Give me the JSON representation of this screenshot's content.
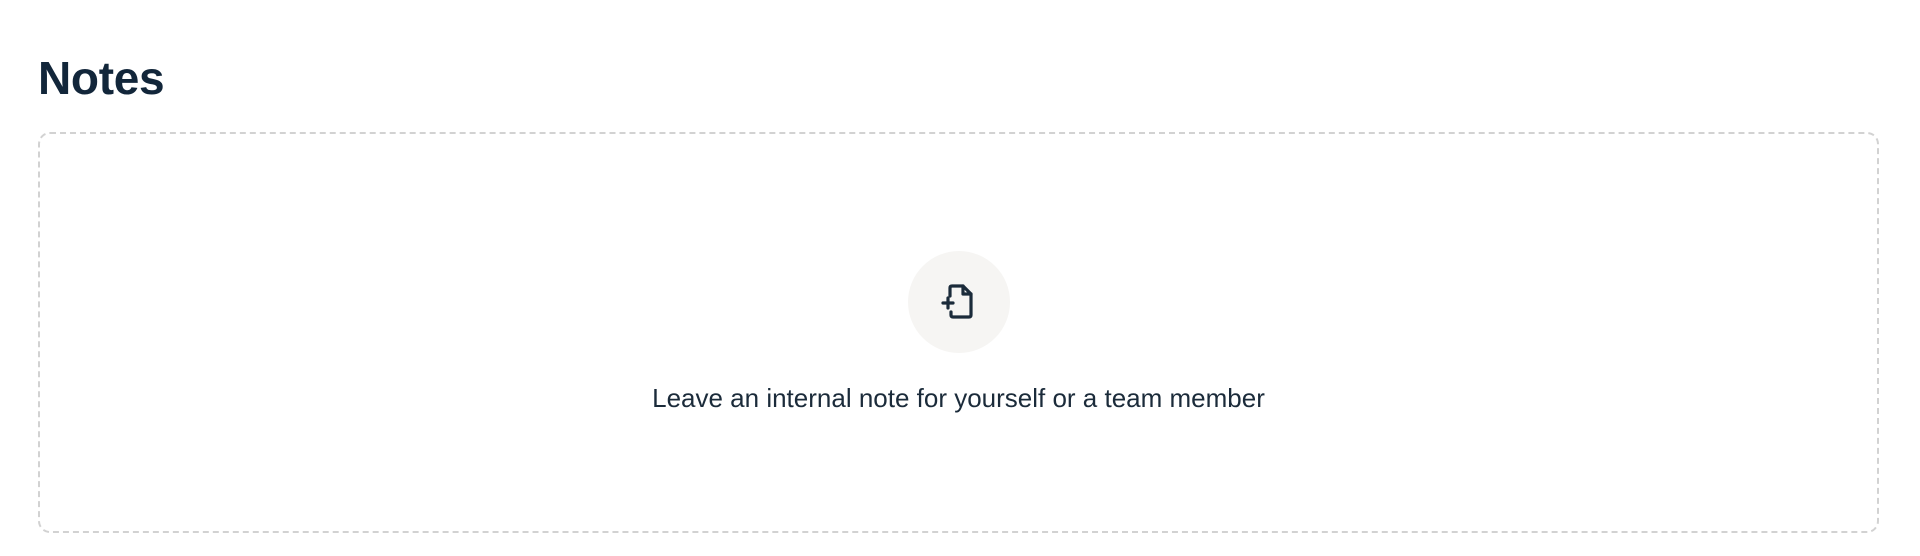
{
  "notes": {
    "title": "Notes",
    "empty_state": {
      "icon": "file-plus-icon",
      "message": "Leave an internal note for yourself or a team member"
    }
  },
  "colors": {
    "title": "#12263a",
    "text": "#1b2b3a",
    "border": "#d2d2d2",
    "icon_bg": "#f6f5f3",
    "icon_stroke": "#1b2b3a"
  }
}
